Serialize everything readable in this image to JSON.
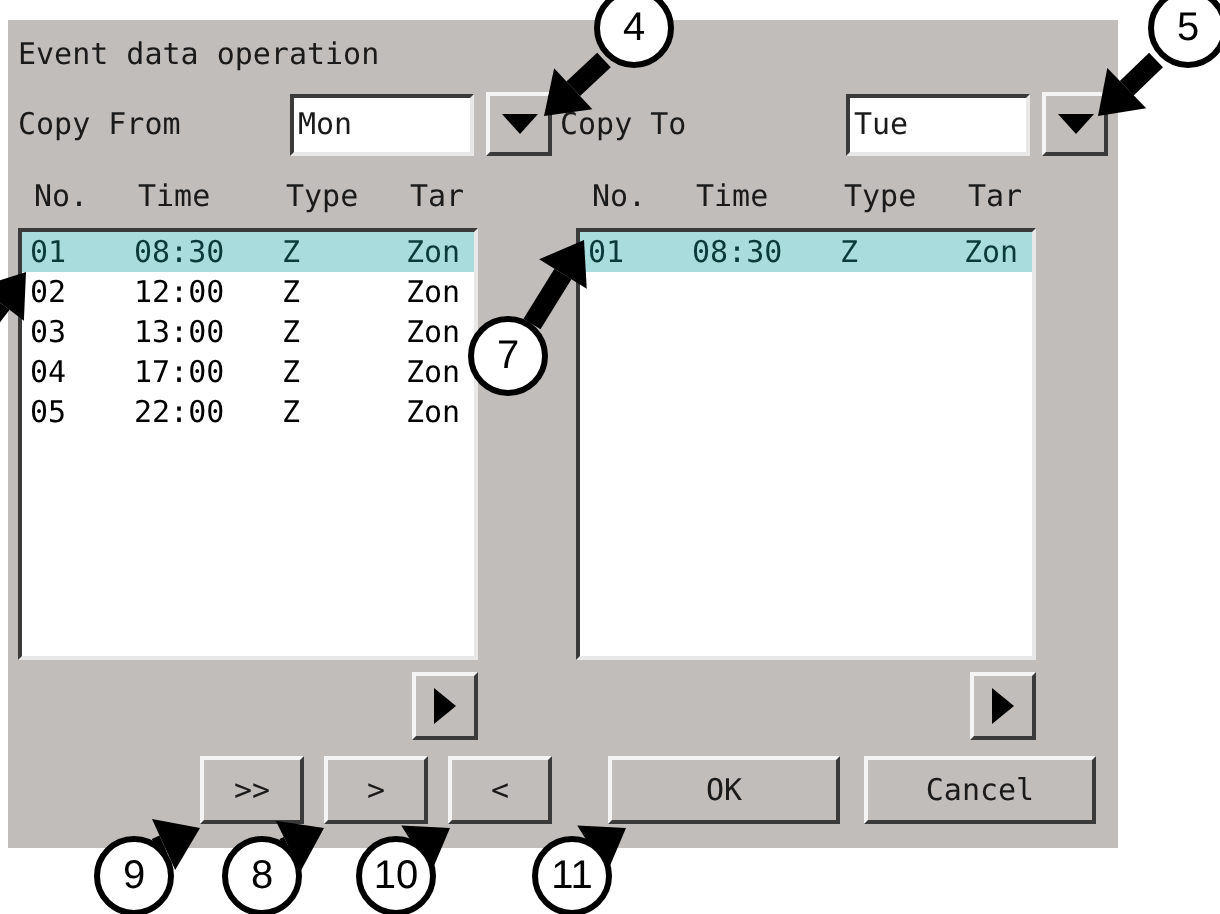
{
  "window": {
    "title": "Event data operation"
  },
  "copy_from": {
    "label": "Copy From",
    "value": "Mon"
  },
  "copy_to": {
    "label": "Copy To",
    "value": "Tue"
  },
  "source_list": {
    "columns": [
      "No.",
      "Time",
      "Type",
      "Tar"
    ],
    "rows": [
      {
        "cells": [
          "01",
          "08:30",
          "Z",
          "Zon"
        ],
        "selected": true
      },
      {
        "cells": [
          "02",
          "12:00",
          "Z",
          "Zon"
        ],
        "selected": false
      },
      {
        "cells": [
          "03",
          "13:00",
          "Z",
          "Zon"
        ],
        "selected": false
      },
      {
        "cells": [
          "04",
          "17:00",
          "Z",
          "Zon"
        ],
        "selected": false
      },
      {
        "cells": [
          "05",
          "22:00",
          "Z",
          "Zon"
        ],
        "selected": false
      }
    ]
  },
  "target_list": {
    "columns": [
      "No.",
      "Time",
      "Type",
      "Tar"
    ],
    "rows": [
      {
        "cells": [
          "01",
          "08:30",
          "Z",
          "Zon"
        ],
        "selected": true
      }
    ]
  },
  "transfer_buttons": [
    ">>",
    ">",
    "<"
  ],
  "dialog_buttons": [
    "OK",
    "Cancel"
  ],
  "callouts": [
    {
      "kind": "numbered",
      "label": "4"
    },
    {
      "kind": "numbered",
      "label": "5"
    },
    {
      "kind": "arrow_only"
    },
    {
      "kind": "numbered",
      "label": "7"
    },
    {
      "kind": "numbered",
      "label": "9"
    },
    {
      "kind": "numbered",
      "label": "8"
    },
    {
      "kind": "numbered",
      "label": "10"
    },
    {
      "kind": "numbered",
      "label": "11"
    }
  ]
}
